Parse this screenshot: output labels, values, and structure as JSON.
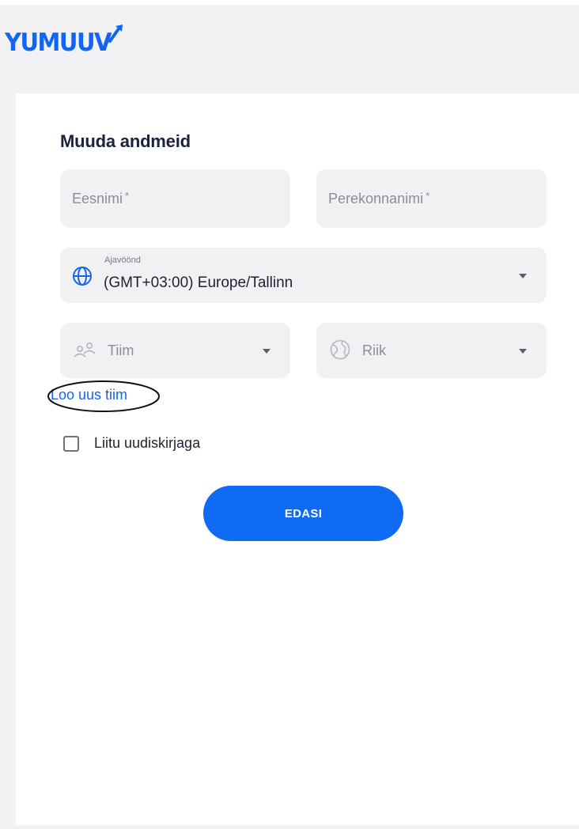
{
  "brand": {
    "logo_text": "YUMUUV",
    "color": "#1066f2"
  },
  "form": {
    "title": "Muuda andmeid",
    "first_name": {
      "placeholder": "Eesnimi",
      "required_mark": "*",
      "value": ""
    },
    "last_name": {
      "placeholder": "Perekonnanimi",
      "required_mark": "*",
      "value": ""
    },
    "timezone": {
      "label": "Ajavöönd",
      "value": "(GMT+03:00) Europe/Tallinn",
      "icon": "globe-icon"
    },
    "team": {
      "placeholder": "Tiim",
      "icon": "people-icon"
    },
    "country": {
      "placeholder": "Riik",
      "icon": "world-map-icon"
    },
    "create_team_link": "Loo uus tiim",
    "newsletter": {
      "label": "Liitu uudiskirjaga",
      "checked": false
    },
    "submit_label": "EDASI"
  },
  "colors": {
    "accent": "#0e6bf2",
    "link": "#1366e8",
    "field_bg": "#f1f1f4",
    "frame_bg": "#f2f2f5",
    "title": "#1c2140"
  }
}
